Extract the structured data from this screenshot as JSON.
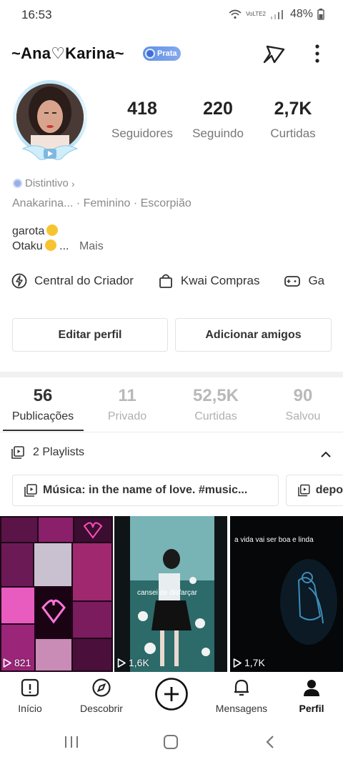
{
  "status_bar": {
    "time": "16:53",
    "network": "VoLTE2",
    "battery": "48%"
  },
  "header": {
    "username": "~Ana♡Karina~",
    "badge": "Prata"
  },
  "stats": [
    {
      "value": "418",
      "label": "Seguidores"
    },
    {
      "value": "220",
      "label": "Seguindo"
    },
    {
      "value": "2,7K",
      "label": "Curtidas"
    }
  ],
  "profile": {
    "distintivo": "Distintivo",
    "info": "Anakarina...  ·  Feminino  ·  Escorpião",
    "bio_line1": "garota",
    "bio_line2": "Otaku",
    "bio_more_dots": "...",
    "bio_more": "Mais"
  },
  "shortcuts": [
    {
      "label": "Central do Criador",
      "icon": "lightning-icon"
    },
    {
      "label": "Kwai Compras",
      "icon": "shopping-bag-icon"
    },
    {
      "label": "Ga",
      "icon": "gamepad-icon"
    }
  ],
  "buttons": {
    "edit": "Editar perfil",
    "add_friends": "Adicionar amigos"
  },
  "tabs": [
    {
      "count": "56",
      "label": "Publicações",
      "active": true
    },
    {
      "count": "11",
      "label": "Privado",
      "active": false
    },
    {
      "count": "52,5K",
      "label": "Curtidas",
      "active": false
    },
    {
      "count": "90",
      "label": "Salvou",
      "active": false
    }
  ],
  "playlists": {
    "title": "2 Playlists",
    "items": [
      "Música: in the name of love. #music...",
      "depo"
    ]
  },
  "posts": [
    {
      "views": "821",
      "caption": ""
    },
    {
      "views": "1,6K",
      "caption": "cansei de disfarçar"
    },
    {
      "views": "1,7K",
      "caption": "a vida vai ser boa e linda"
    }
  ],
  "bottom_nav": [
    {
      "label": "Início",
      "icon": "home-icon"
    },
    {
      "label": "Descobrir",
      "icon": "compass-icon"
    },
    {
      "label": "",
      "icon": "plus-circle-icon"
    },
    {
      "label": "Mensagens",
      "icon": "bell-icon"
    },
    {
      "label": "Perfil",
      "icon": "person-icon",
      "active": true
    }
  ],
  "colors": {
    "accent": "#333333",
    "badge": "#5c8fe4",
    "muted": "#8a8a8a"
  }
}
